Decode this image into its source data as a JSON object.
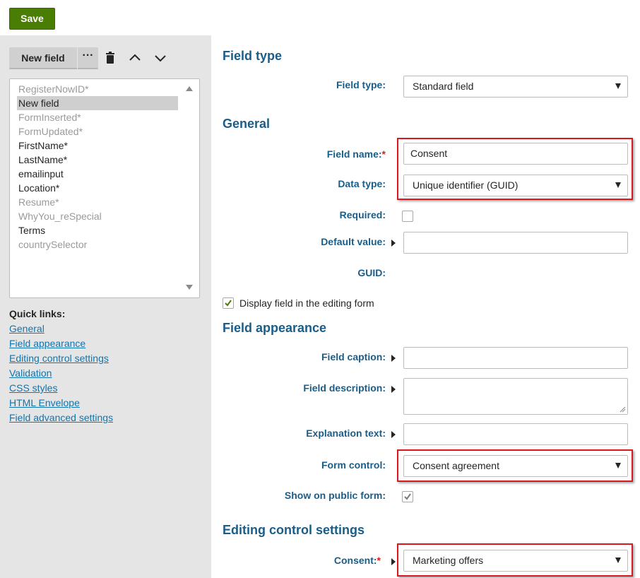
{
  "toolbar": {
    "save_label": "Save"
  },
  "sidebar": {
    "new_field_label": "New field",
    "more_label": "···",
    "fields": [
      {
        "label": "RegisterNowID*",
        "state": "muted"
      },
      {
        "label": "New field",
        "state": "selected"
      },
      {
        "label": "FormInserted*",
        "state": "muted"
      },
      {
        "label": "FormUpdated*",
        "state": "muted"
      },
      {
        "label": "FirstName*",
        "state": "normal"
      },
      {
        "label": "LastName*",
        "state": "normal"
      },
      {
        "label": "emailinput",
        "state": "normal"
      },
      {
        "label": "Location*",
        "state": "normal"
      },
      {
        "label": "Resume*",
        "state": "muted"
      },
      {
        "label": "WhyYou_reSpecial",
        "state": "muted"
      },
      {
        "label": "Terms",
        "state": "normal"
      },
      {
        "label": "countrySelector",
        "state": "muted"
      }
    ],
    "quick_links_title": "Quick links:",
    "quick_links": [
      "General",
      "Field appearance",
      "Editing control settings",
      "Validation",
      "CSS styles",
      "HTML Envelope",
      "Field advanced settings"
    ]
  },
  "form": {
    "field_type_section": "Field type",
    "field_type_label": "Field type:",
    "field_type_value": "Standard field",
    "general_section": "General",
    "field_name_label": "Field name:",
    "required_star": "*",
    "field_name_value": "Consent",
    "data_type_label": "Data type:",
    "data_type_value": "Unique identifier (GUID)",
    "required_label": "Required:",
    "required_checked": false,
    "default_value_label": "Default value:",
    "default_value": "",
    "guid_label": "GUID:",
    "display_in_form_label": "Display field in the editing form",
    "display_in_form_checked": true,
    "appearance_section": "Field appearance",
    "field_caption_label": "Field caption:",
    "field_caption_value": "",
    "field_description_label": "Field description:",
    "field_description_value": "",
    "explanation_text_label": "Explanation text:",
    "explanation_text_value": "",
    "form_control_label": "Form control:",
    "form_control_value": "Consent agreement",
    "show_public_label": "Show on public form:",
    "show_public_checked": true,
    "editing_section": "Editing control settings",
    "consent_label": "Consent:",
    "consent_value": "Marketing offers"
  },
  "colors": {
    "save_button": "#497d04",
    "section_title": "#1a5d89",
    "link": "#1175ae",
    "highlight": "#d9181f",
    "sidebar_bg": "#e5e5e5"
  }
}
